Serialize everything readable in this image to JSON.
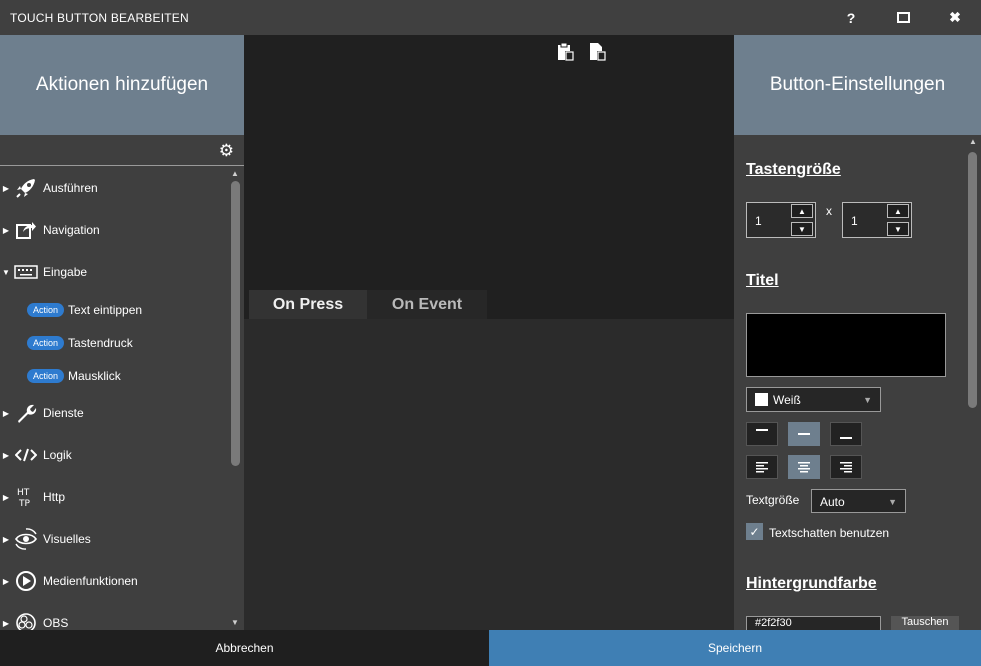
{
  "window": {
    "title": "TOUCH BUTTON BEARBEITEN",
    "help_label": "?",
    "close_label": "✖"
  },
  "left_panel": {
    "header": "Aktionen hinzufügen",
    "categories": [
      {
        "label": "Ausführen",
        "icon": "rocket-icon",
        "expanded": false
      },
      {
        "label": "Navigation",
        "icon": "share-icon",
        "expanded": false
      },
      {
        "label": "Eingabe",
        "icon": "keyboard-icon",
        "expanded": true
      },
      {
        "label": "Dienste",
        "icon": "wrench-icon",
        "expanded": false
      },
      {
        "label": "Logik",
        "icon": "code-icon",
        "expanded": false
      },
      {
        "label": "Http",
        "icon": "http-icon",
        "expanded": false
      },
      {
        "label": "Visuelles",
        "icon": "eye-icon",
        "expanded": false
      },
      {
        "label": "Medienfunktionen",
        "icon": "play-icon",
        "expanded": false
      },
      {
        "label": "OBS",
        "icon": "obs-icon",
        "expanded": false
      }
    ],
    "eingabe_actions": [
      {
        "badge": "Action",
        "label": "Text eintippen"
      },
      {
        "badge": "Action",
        "label": "Tastendruck"
      },
      {
        "badge": "Action",
        "label": "Mausklick"
      }
    ]
  },
  "middle": {
    "tabs": [
      {
        "label": "On Press",
        "active": true
      },
      {
        "label": "On Event",
        "active": false
      }
    ]
  },
  "right_panel": {
    "header": "Button-Einstellungen",
    "size": {
      "title": "Tastengröße",
      "width_value": "1",
      "height_value": "1",
      "separator": "x"
    },
    "title_section": {
      "title": "Titel",
      "text_value": "",
      "color_label": "Weiß",
      "font_size_label": "Textgröße",
      "font_size_value": "Auto",
      "shadow_label": "Textschatten benutzen",
      "shadow_checked": true
    },
    "background": {
      "title": "Hintergrundfarbe",
      "color_value": "#2f2f30",
      "swap_label": "Tauschen"
    }
  },
  "footer": {
    "cancel_label": "Abbrechen",
    "save_label": "Speichern"
  },
  "colors": {
    "accent": "#6e7f8e",
    "save": "#3f7fb4",
    "badge": "#2e7bcf"
  }
}
